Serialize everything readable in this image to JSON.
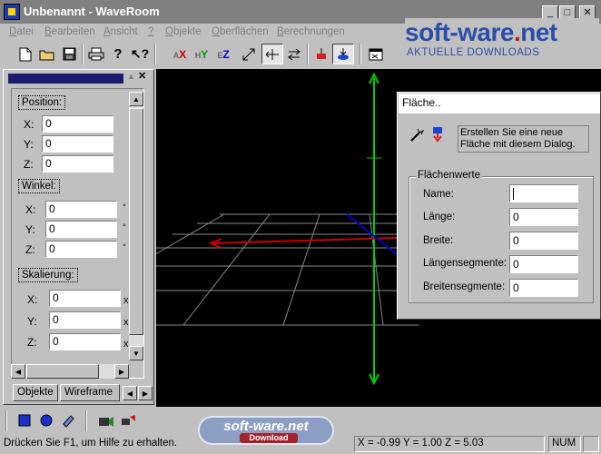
{
  "window": {
    "title": "Unbenannt - WaveRoom",
    "minimize": "_",
    "maximize": "□",
    "close": "✕"
  },
  "logo": {
    "brand_main": "soft-ware",
    "brand_dot": ".",
    "brand_tld": "net",
    "tagline": "AKTUELLE DOWNLOADS"
  },
  "menu": [
    {
      "u": "D",
      "rest": "atei"
    },
    {
      "u": "B",
      "rest": "earbeiten"
    },
    {
      "u": "A",
      "rest": "nsicht"
    },
    {
      "u": "?",
      "rest": ""
    },
    {
      "u": "O",
      "rest": "bjekte"
    },
    {
      "u": "O",
      "rest": "berflächen"
    },
    {
      "u": "B",
      "rest": "erechnungen"
    }
  ],
  "toolbar_icons": [
    "new-file-icon",
    "open-folder-icon",
    "save-icon",
    "print-icon",
    "help-icon",
    "context-help-icon",
    "axis-x-icon",
    "axis-y-icon",
    "axis-z-icon",
    "scale-icon",
    "move-horizontal-icon",
    "move-vertical-icon",
    "red-object-icon",
    "blue-object-icon",
    "properties-icon"
  ],
  "panel": {
    "collapse": "▲",
    "close": "✕",
    "position_label": "Position:",
    "rotation_label": "Winkel:",
    "scale_label": "Skalierung:",
    "x": "X:",
    "y": "Y:",
    "z": "Z:",
    "position": {
      "x": "0",
      "y": "0",
      "z": "0"
    },
    "rotation": {
      "x": "0",
      "y": "0",
      "z": "0"
    },
    "scale": {
      "x": "0",
      "y": "0",
      "z": "0"
    },
    "deg": "°",
    "scale_unit": "x",
    "scroll_up": "▲",
    "scroll_down": "▼",
    "scroll_left": "◀",
    "scroll_right": "▶",
    "tabs": [
      "Objekte",
      "Wireframe"
    ]
  },
  "dialog": {
    "title": "Fläche..",
    "hint": "Erstellen Sie eine neue Fläche mit diesem Dialog.",
    "group_title": "Flächenwerte",
    "fields": [
      {
        "label": "Name:",
        "value": ""
      },
      {
        "label": "Länge:",
        "value": "0"
      },
      {
        "label": "Breite:",
        "value": "0"
      },
      {
        "label": "Längensegmente:",
        "value": "0"
      },
      {
        "label": "Breitensegmente:",
        "value": "0"
      }
    ]
  },
  "watermark": {
    "main": "soft-ware.net",
    "sub": "Download"
  },
  "status": {
    "help": "Drücken Sie F1, um Hilfe zu erhalten.",
    "coords": "X = -0.99  Y = 1.00  Z = 5.03",
    "num": "NUM"
  },
  "colors": {
    "title_bar": "#808080",
    "grid": "#8a8a8a",
    "axis_y": "#00cc00",
    "axis_x": "#cc0000",
    "axis_z": "#0000cc",
    "brand": "#2b4ea8"
  }
}
